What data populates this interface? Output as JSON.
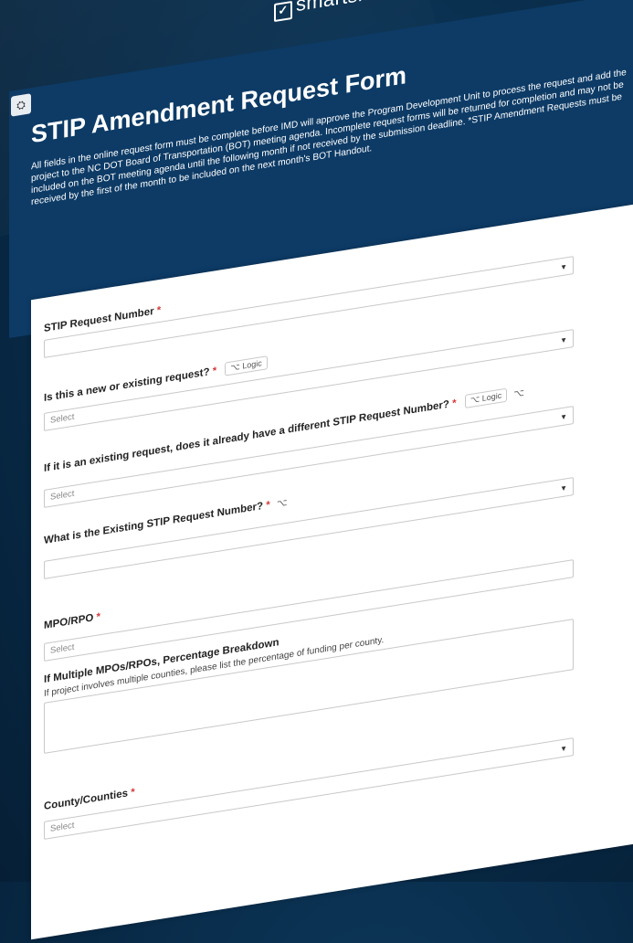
{
  "brand": {
    "logo_text": "smartsheet"
  },
  "form": {
    "title": "STIP Amendment Request Form",
    "description": "All fields in the online request form must be complete before IMD will approve the Program Development Unit to process the request and add the project to the NC DOT Board of Transportation (BOT) meeting agenda. Incomplete request forms will be returned for completion and may not be included on the BOT meeting agenda until the following month if not received by the submission deadline. *STIP Amendment Requests must be received by the first of the month to be included on the next month's BOT Handout."
  },
  "questions": [
    {
      "label": "STIP Request Number",
      "required": "*"
    },
    {
      "label": "Is this a new or existing request?",
      "required": "*",
      "logic": "Logic",
      "placeholder": "Select"
    },
    {
      "label": "If it is an existing request, does it already have a different STIP Request Number?",
      "required": "*",
      "logic": "Logic",
      "placeholder": "Select"
    },
    {
      "label": "What is the Existing STIP Request Number?",
      "required": "*"
    },
    {
      "label": "MPO/RPO",
      "required": "*",
      "placeholder": "Select"
    },
    {
      "label": "If Multiple MPOs/RPOs, Percentage Breakdown",
      "help": "If project involves multiple counties, please list the percentage of funding per county."
    },
    {
      "label": "County/Counties",
      "required": "*",
      "placeholder": "Select"
    }
  ]
}
